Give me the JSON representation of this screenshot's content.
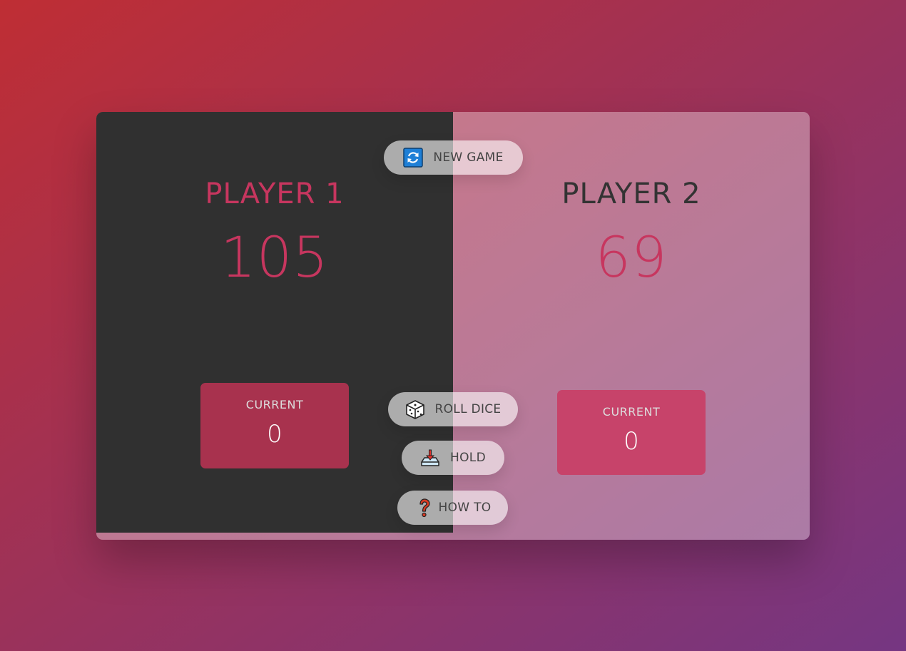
{
  "players": [
    {
      "name": "PLAYER 1",
      "score": "105",
      "current_label": "CURRENT",
      "current_score": "0",
      "active": true
    },
    {
      "name": "PLAYER 2",
      "score": "69",
      "current_label": "CURRENT",
      "current_score": "0",
      "active": false
    }
  ],
  "buttons": {
    "new_game": {
      "label": "NEW GAME",
      "icon": "refresh-icon"
    },
    "roll_dice": {
      "label": "ROLL DICE",
      "icon": "dice-icon"
    },
    "hold": {
      "label": "HOLD",
      "icon": "hold-icon"
    },
    "how_to": {
      "label": "HOW TO",
      "icon": "question-icon"
    }
  },
  "colors": {
    "accent": "#c7365f",
    "active_panel": "#303030",
    "background_start": "#bf2e34",
    "background_end": "#753682"
  }
}
